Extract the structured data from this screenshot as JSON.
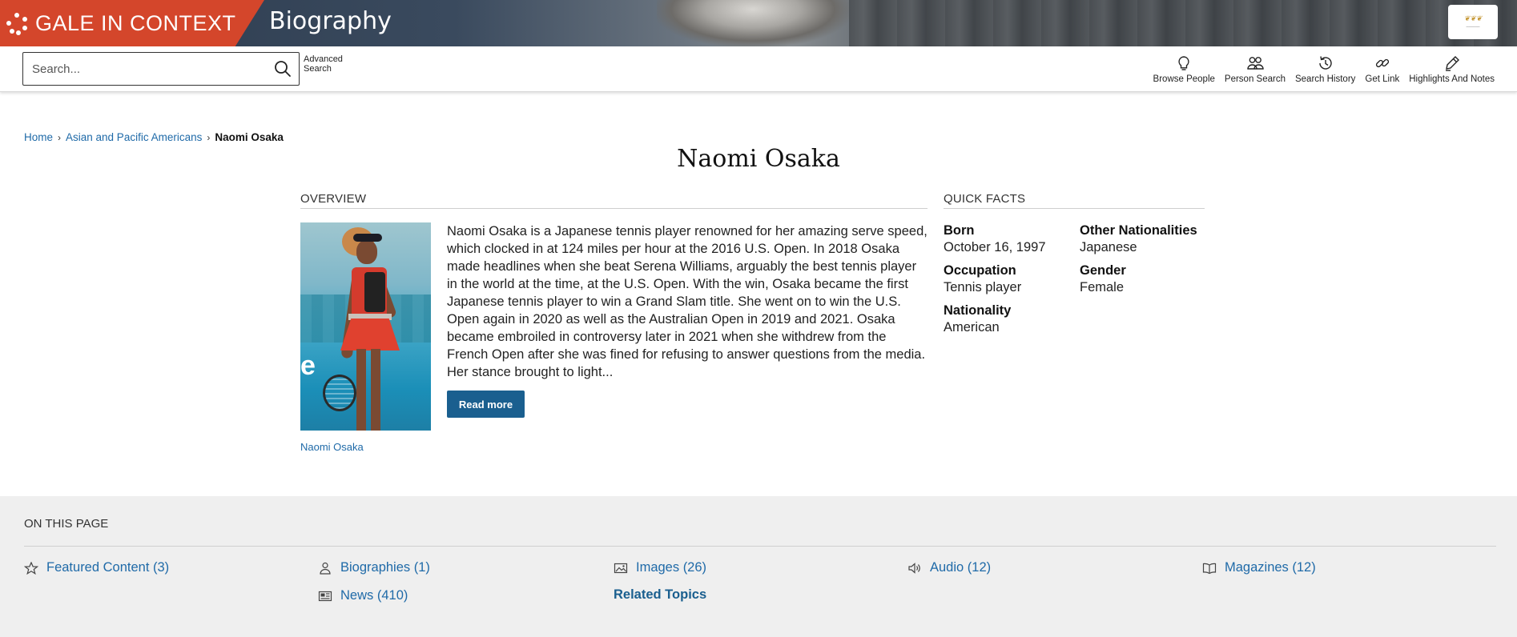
{
  "header": {
    "brand": "GALE IN CONTEXT",
    "product": "Biography",
    "colors": {
      "brand": "#d4462b",
      "link": "#1f6aa8",
      "button": "#1a5f8f"
    }
  },
  "search": {
    "placeholder": "Search...",
    "advanced_line1": "Advanced",
    "advanced_line2": "Search"
  },
  "tools": [
    {
      "label": "Browse People",
      "icon": "lightbulb-icon"
    },
    {
      "label": "Person Search",
      "icon": "people-icon"
    },
    {
      "label": "Search History",
      "icon": "history-icon"
    },
    {
      "label": "Get Link",
      "icon": "link-icon"
    },
    {
      "label": "Highlights And Notes",
      "icon": "pen-icon"
    }
  ],
  "breadcrumb": {
    "home": "Home",
    "category": "Asian and Pacific Americans",
    "current": "Naomi Osaka"
  },
  "page_title": "Naomi Osaka",
  "overview": {
    "heading": "OVERVIEW",
    "image_caption": "Naomi Osaka",
    "summary": "Naomi Osaka is a Japanese tennis player renowned for her amazing serve speed, which clocked in at 124 miles per hour at the 2016 U.S. Open. In 2018 Osaka made headlines when she beat Serena Williams, arguably the best tennis player in the world at the time, at the U.S. Open. With the win, Osaka became the first Japanese tennis player to win a Grand Slam title. She went on to win the U.S. Open again in 2020 as well as the Australian Open in 2019 and 2021. Osaka became embroiled in controversy later in 2021 when she withdrew from the French Open after she was fined for refusing to answer questions from the media. Her stance brought to light...",
    "read_more": "Read more"
  },
  "quick_facts": {
    "heading": "QUICK FACTS",
    "born_label": "Born",
    "born_value": "October 16, 1997",
    "other_nat_label": "Other Nationalities",
    "other_nat_value": "Japanese",
    "occupation_label": "Occupation",
    "occupation_value": "Tennis player",
    "gender_label": "Gender",
    "gender_value": "Female",
    "nationality_label": "Nationality",
    "nationality_value": "American"
  },
  "on_this_page": {
    "heading": "ON THIS PAGE",
    "featured": "Featured Content (3)",
    "biographies": "Biographies (1)",
    "images": "Images (26)",
    "audio": "Audio (12)",
    "magazines": "Magazines (12)",
    "news": "News (410)",
    "related": "Related Topics"
  }
}
